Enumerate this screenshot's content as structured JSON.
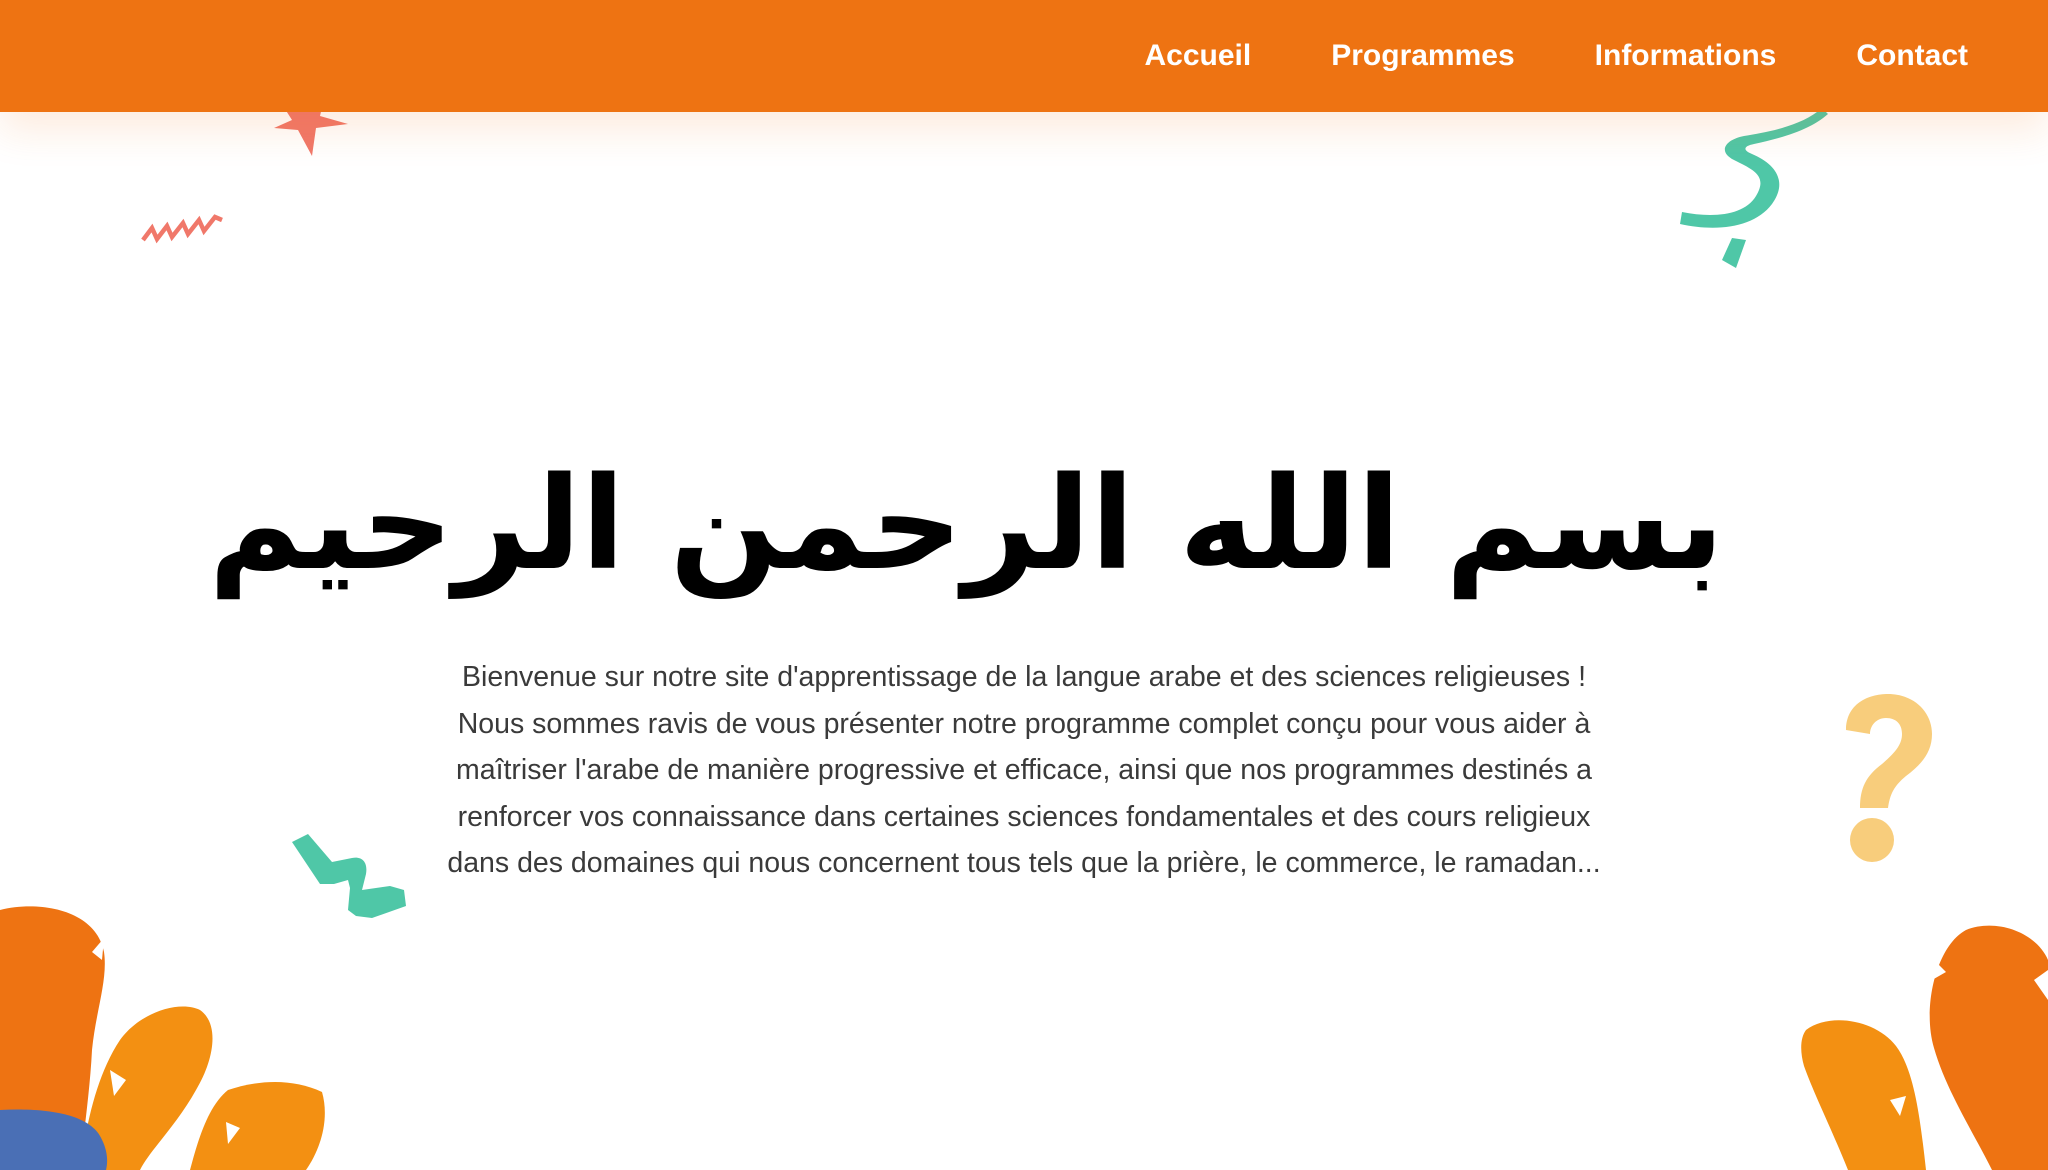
{
  "nav": {
    "items": [
      {
        "label": "Accueil"
      },
      {
        "label": "Programmes"
      },
      {
        "label": "Informations"
      },
      {
        "label": "Contact"
      }
    ]
  },
  "hero": {
    "title": "بسم الله الرحمن الرحيم",
    "lines": [
      "Bienvenue sur notre site d'apprentissage de la langue arabe et des sciences religieuses !",
      "Nous sommes ravis de vous présenter notre programme complet conçu pour vous aider à",
      "maîtriser l'arabe de manière progressive et efficace, ainsi que nos programmes destinés a",
      "renforcer vos connaissance dans certaines sciences fondamentales et des cours religieux",
      "dans des domaines qui nous concernent tous tels que la prière, le commerce, le ramadan..."
    ]
  },
  "colors": {
    "brand_orange": "#ee7312",
    "light_orange": "#f39012",
    "teal": "#4fc7a7",
    "coral": "#f0786a",
    "yellow": "#f8cd7c",
    "blue": "#4a6fb5"
  }
}
